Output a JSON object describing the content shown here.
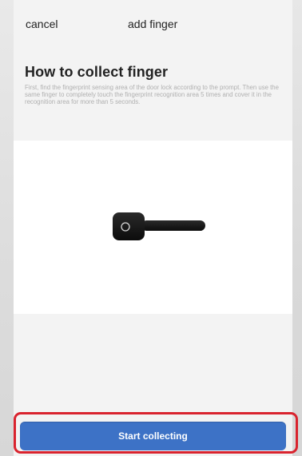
{
  "header": {
    "cancel_label": "cancel",
    "title": "add finger"
  },
  "instructions": {
    "heading": "How to collect finger",
    "description": "First, find the fingerprint sensing area of the door lock according to the prompt. Then use the same finger to completely touch the fingerprint recognition area 5 times and cover it in the recognition area for more than 5 seconds."
  },
  "illustration": {
    "icon": "door-lock-handle-icon"
  },
  "footer": {
    "start_label": "Start collecting"
  },
  "colors": {
    "primary_button": "#3d72c6",
    "highlight_border": "#d9232e",
    "page_background": "#f3f3f3"
  }
}
